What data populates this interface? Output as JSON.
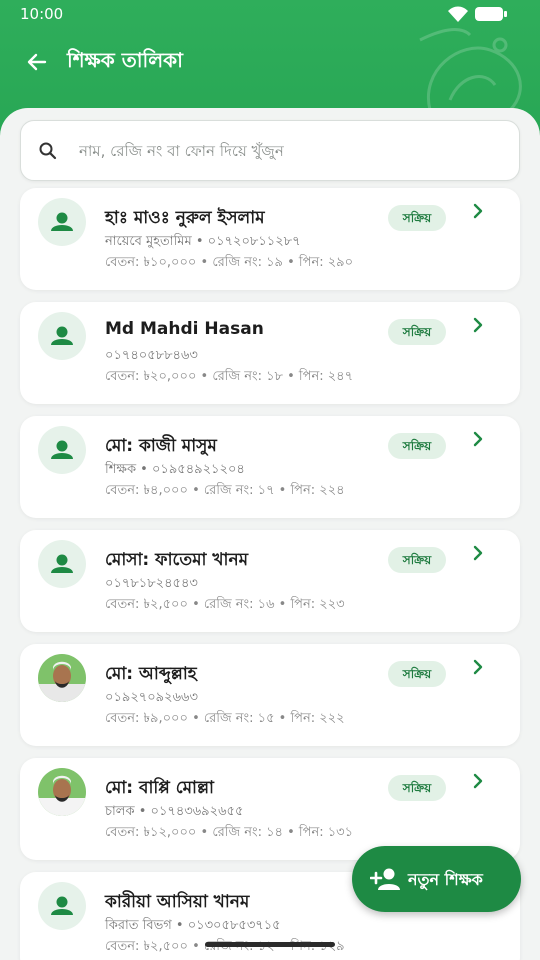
{
  "status_bar": {
    "time": "10:00"
  },
  "header": {
    "title": "শিক্ষক তালিকা"
  },
  "search": {
    "placeholder": "নাম, রেজি নং বা ফোন দিয়ে খুঁজুন",
    "value": ""
  },
  "teachers": [
    {
      "name": "হাঃ মাওঃ নুরুল ইসলাম",
      "line1": "নায়েবে মুহতামিম • ০১৭২০৮১১২৮৭",
      "line2": "বেতন: ৳১০,০০০ • রেজি নং: ১৯ • পিন: ২৯০",
      "status": "সক্রিয়",
      "avatar": "person-icon"
    },
    {
      "name": "Md Mahdi Hasan",
      "line1": "০১৭৪০৫৮৮৪৬৩",
      "line2": "বেতন: ৳২০,০০০ • রেজি নং: ১৮ • পিন: ২৪৭",
      "status": "সক্রিয়",
      "avatar": "person-icon"
    },
    {
      "name": "মো: কাজী মাসুম",
      "line1": "শিক্ষক • ০১৯৫৪৯২১২০৪",
      "line2": "বেতন: ৳৪,০০০ • রেজি নং: ১৭ • পিন: ২২৪",
      "status": "সক্রিয়",
      "avatar": "person-icon"
    },
    {
      "name": "মোসা: ফাতেমা খানম",
      "line1": "০১৭৮১৮২৪৫৪৩",
      "line2": "বেতন: ৳২,৫০০ • রেজি নং: ১৬ • পিন: ২২৩",
      "status": "সক্রিয়",
      "avatar": "person-icon"
    },
    {
      "name": "মো: আব্দুল্লাহ",
      "line1": "০১৯২৭০৯২৬৬৩",
      "line2": "বেতন: ৳৯,০০০ • রেজি নং: ১৫ • পিন: ২২২",
      "status": "সক্রিয়",
      "avatar": "photo"
    },
    {
      "name": "মো: বাপ্পি মোল্লা",
      "line1": "চালক • ০১৭৪৩৬৯২৬৫৫",
      "line2": "বেতন: ৳১২,০০০ • রেজি নং: ১৪ • পিন: ১৩১",
      "status": "সক্রিয়",
      "avatar": "photo"
    },
    {
      "name": "কারীয়া আসিয়া খানম",
      "line1": "কিরাত বিভগ • ০১৩০৫৮৫৩৭১৫",
      "line2": "বেতন: ৳২,৫০০ • রেজি নং: ১২ • পিন: ১২৯",
      "status": "",
      "avatar": "person-icon"
    }
  ],
  "fab": {
    "label": "নতুন শিক্ষক",
    "icon": "add-person-icon"
  },
  "colors": {
    "primary": "#2fae5b",
    "dark_green": "#1e8a44",
    "badge_bg": "#e2f1e6",
    "badge_text": "#1d7a3e"
  }
}
